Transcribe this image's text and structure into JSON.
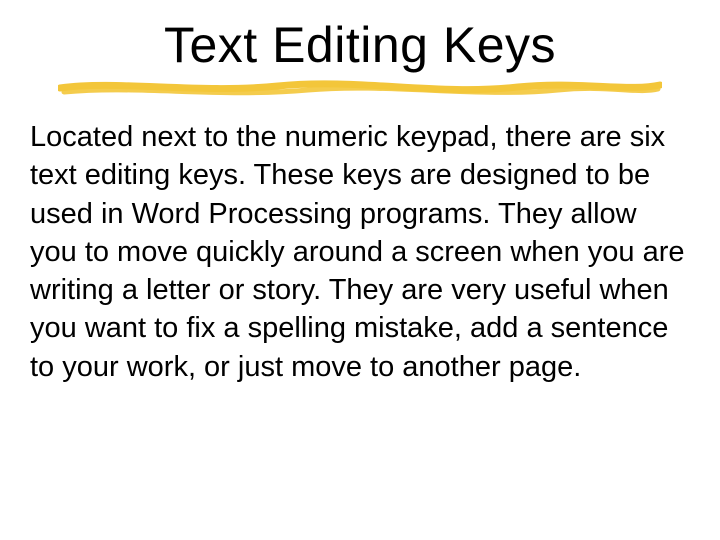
{
  "slide": {
    "title": "Text Editing Keys",
    "body": "Located next to the numeric keypad, there are six text editing keys.  These keys are designed to be used in Word Processing programs.  They allow you to move quickly around a screen when you are writing a letter or story.  They are very useful when you want to fix a spelling mistake, add a sentence to your work, or just move to another page."
  },
  "colors": {
    "underline": "#f3c63a"
  }
}
